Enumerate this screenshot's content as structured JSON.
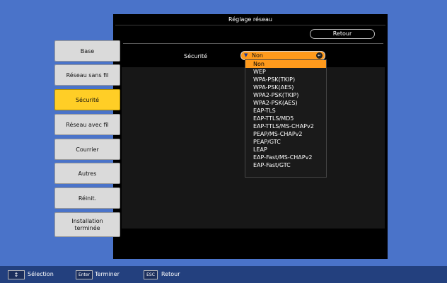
{
  "window": {
    "title": "Réglage réseau"
  },
  "header": {
    "back_label": "Retour"
  },
  "sidebar": {
    "items": [
      {
        "label": "Base"
      },
      {
        "label": "Réseau sans fil"
      },
      {
        "label": "Sécurité",
        "active": true
      },
      {
        "label": "Réseau avec fil"
      },
      {
        "label": "Courrier"
      },
      {
        "label": "Autres"
      },
      {
        "label": "Réinit."
      },
      {
        "label": "Installation\nterminée"
      }
    ]
  },
  "security": {
    "label": "Sécurité",
    "selected": "Non",
    "options": [
      "Non",
      "WEP",
      "WPA-PSK(TKIP)",
      "WPA-PSK(AES)",
      "WPA2-PSK(TKIP)",
      "WPA2-PSK(AES)",
      "EAP-TLS",
      "EAP-TTLS/MD5",
      "EAP-TTLS/MS-CHAPv2",
      "PEAP/MS-CHAPv2",
      "PEAP/GTC",
      "LEAP",
      "EAP-Fast/MS-CHAPv2",
      "EAP-Fast/GTC"
    ]
  },
  "footer": {
    "select_key": "↕",
    "select_label": "Sélection",
    "enter_key": "Enter",
    "enter_label": "Terminer",
    "esc_key": "ESC",
    "esc_label": "Retour"
  },
  "colors": {
    "background": "#4a73c9",
    "accent": "#ff9a1c",
    "active_tab": "#ffce26",
    "footer": "#23407e"
  }
}
